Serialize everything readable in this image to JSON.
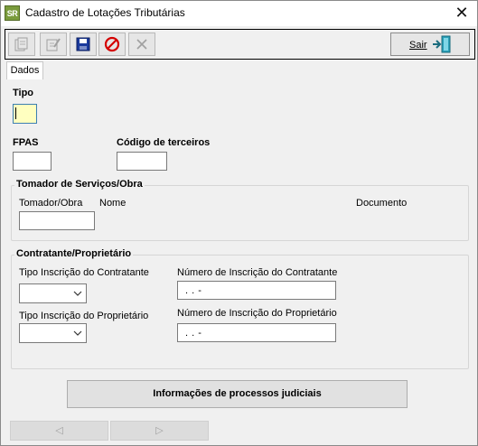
{
  "window": {
    "app_icon": "SR",
    "title": "Cadastro de Lotações Tributárias",
    "close_glyph": "✕"
  },
  "toolbar": {
    "buttons": [
      {
        "name": "new-record-icon",
        "enabled": false
      },
      {
        "name": "edit-record-icon",
        "enabled": false
      },
      {
        "name": "save-icon",
        "enabled": true
      },
      {
        "name": "cancel-icon",
        "enabled": true
      },
      {
        "name": "delete-icon",
        "enabled": false
      }
    ],
    "exit_label": "Sair"
  },
  "tabs": [
    {
      "label": "Dados",
      "active": true
    }
  ],
  "form": {
    "tipo_label": "Tipo",
    "tipo_value": "",
    "fpas_label": "FPAS",
    "fpas_value": "",
    "codigo_terceiros_label": "Código de terceiros",
    "codigo_terceiros_value": ""
  },
  "tomador_group": {
    "title": "Tomador de Serviços/Obra",
    "tomador_obra_label": "Tomador/Obra",
    "tomador_obra_value": "",
    "nome_label": "Nome",
    "documento_label": "Documento"
  },
  "contratante_group": {
    "title": "Contratante/Proprietário",
    "tipo_inscricao_contratante_label": "Tipo Inscrição do Contratante",
    "tipo_inscricao_contratante_value": "",
    "numero_inscricao_contratante_label": "Número de Inscrição do Contratante",
    "numero_inscricao_contratante_value": " .  .  -",
    "tipo_inscricao_proprietario_label": "Tipo Inscrição do Proprietário",
    "tipo_inscricao_proprietario_value": "",
    "numero_inscricao_proprietario_label": "Número de Inscrição do Proprietário",
    "numero_inscricao_proprietario_value": " .  .  -"
  },
  "actions": {
    "processos_label": "Informações de processos judiciais",
    "prev_glyph": "◁",
    "next_glyph": "▷"
  },
  "colors": {
    "focused_field": "#ffffc0",
    "cancel_red": "#d40000",
    "save_blue": "#1a3a9c"
  }
}
